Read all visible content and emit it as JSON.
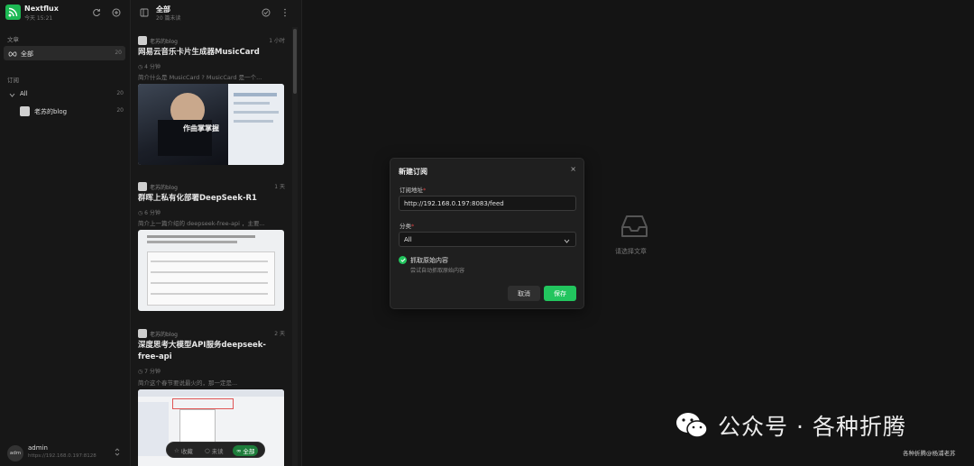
{
  "app": {
    "name": "Nextflux",
    "subtitle": "今天 15:21"
  },
  "sidebar": {
    "articles_label": "文章",
    "all": {
      "label": "全部",
      "count": "20"
    },
    "subscriptions_label": "订阅",
    "category": {
      "label": "All",
      "count": "20"
    },
    "feeds": [
      {
        "label": "老苏的blog",
        "count": "20"
      }
    ],
    "user": {
      "avatar": "adm",
      "name": "admin",
      "url": "https://192.168.0.197:8128"
    }
  },
  "list": {
    "title": "全部",
    "subtitle": "20 篇未读",
    "articles": [
      {
        "source": "老苏的blog",
        "time": "1 小时",
        "title": "网易云音乐卡片生成器MusicCard",
        "read_time": "4 分钟",
        "desc": "简介什么是 MusicCard ? MusicCard 是一个..."
      },
      {
        "source": "老苏的blog",
        "time": "1 天",
        "title": "群晖上私有化部署DeepSeek-R1",
        "read_time": "6 分钟",
        "desc": "简介上一篇介绍的 deepseek-free-api ，主要..."
      },
      {
        "source": "老苏的blog",
        "time": "2 天",
        "title": "深度思考大模型API服务deepseek-free-api",
        "read_time": "7 分钟",
        "desc": "简介这个春节要说最火的，那一定是..."
      }
    ],
    "thumb_caption": "作曲掌掌握",
    "filters": [
      {
        "label": "收藏"
      },
      {
        "label": "未读"
      },
      {
        "label": "全部"
      }
    ],
    "active_filter": "全部"
  },
  "content": {
    "empty_text": "请选择文章"
  },
  "modal": {
    "title": "新建订阅",
    "url_label": "订阅地址",
    "url_value": "http://192.168.0.197:8083/feed",
    "category_label": "分类",
    "category_value": "All",
    "crawler_label": "抓取原始内容",
    "crawler_desc": "尝试自动抓取原始内容",
    "cancel": "取消",
    "save": "保存"
  },
  "watermark": {
    "text": "公众号 · 各种折腾",
    "sub": "各种折腾@杨浦老苏"
  },
  "colors": {
    "accent": "#22c55e",
    "bg": "#121212",
    "panel": "#1f1f1f"
  }
}
